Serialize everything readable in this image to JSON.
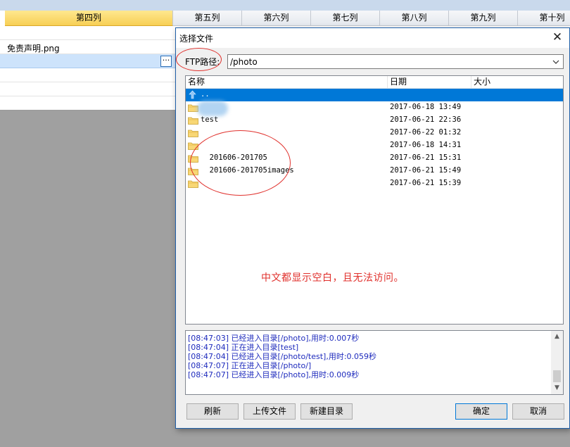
{
  "sheet": {
    "columns": [
      {
        "label": "第四列",
        "active": true
      },
      {
        "label": "第五列"
      },
      {
        "label": "第六列"
      },
      {
        "label": "第七列"
      },
      {
        "label": "第八列"
      },
      {
        "label": "第九列"
      },
      {
        "label": "第十列"
      }
    ],
    "cell_text": "免责声明.png",
    "ellipsis_label": "···"
  },
  "dialog": {
    "title": "选择文件",
    "close_glyph": "✕",
    "path_label": "FTP路径:",
    "path_value": "/photo",
    "columns": {
      "name": "名称",
      "date": "日期",
      "size": "大小"
    },
    "files": [
      {
        "name": "..",
        "date": "",
        "icon": "up-arrow-icon",
        "selected": true
      },
      {
        "name": "",
        "date": "2017-06-18 13:49",
        "icon": "folder-icon"
      },
      {
        "name": "test",
        "date": "2017-06-21 22:36",
        "icon": "folder-icon"
      },
      {
        "name": "",
        "date": "2017-06-22 01:32",
        "icon": "folder-icon"
      },
      {
        "name": "",
        "date": "2017-06-18 14:31",
        "icon": "folder-icon"
      },
      {
        "name": "  201606-201705",
        "date": "2017-06-21 15:31",
        "icon": "folder-icon"
      },
      {
        "name": "  201606-201705images",
        "date": "2017-06-21 15:49",
        "icon": "folder-icon"
      },
      {
        "name": "",
        "date": "2017-06-21 15:39",
        "icon": "folder-icon"
      }
    ],
    "annotation": "中文都显示空白，且无法访问。",
    "log": [
      "[08:47:03] 已经进入目录[/photo],用时:0.007秒",
      "[08:47:04] 正在进入目录[test]",
      "[08:47:04] 已经进入目录[/photo/test],用时:0.059秒",
      "[08:47:07] 正在进入目录[/photo/]",
      "[08:47:07] 已经进入目录[/photo],用时:0.009秒"
    ],
    "buttons": {
      "refresh": "刷新",
      "upload": "上传文件",
      "new_dir": "新建目录",
      "ok": "确定",
      "cancel": "取消"
    }
  },
  "colors": {
    "selection": "#0078d7",
    "annotation": "#e0302c",
    "log_text": "#1e2bbd",
    "active_column": "#f7cf55"
  }
}
